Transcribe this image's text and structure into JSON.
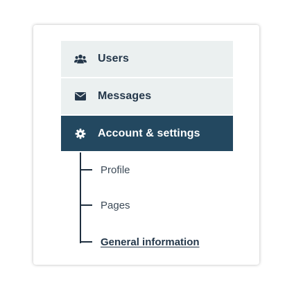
{
  "colors": {
    "inactive_bg": "#ebf0f0",
    "active_bg": "#234860",
    "text_dark": "#24374a",
    "tree_line": "#1f2f3f"
  },
  "menu": {
    "items": [
      {
        "label": "Users",
        "icon": "users-icon",
        "active": false
      },
      {
        "label": "Messages",
        "icon": "envelope-icon",
        "active": false
      },
      {
        "label": "Account & settings",
        "icon": "gear-icon",
        "active": true
      }
    ],
    "submenu": [
      {
        "label": "Profile",
        "current": false
      },
      {
        "label": "Pages",
        "current": false
      },
      {
        "label": "General information",
        "current": true
      }
    ]
  }
}
